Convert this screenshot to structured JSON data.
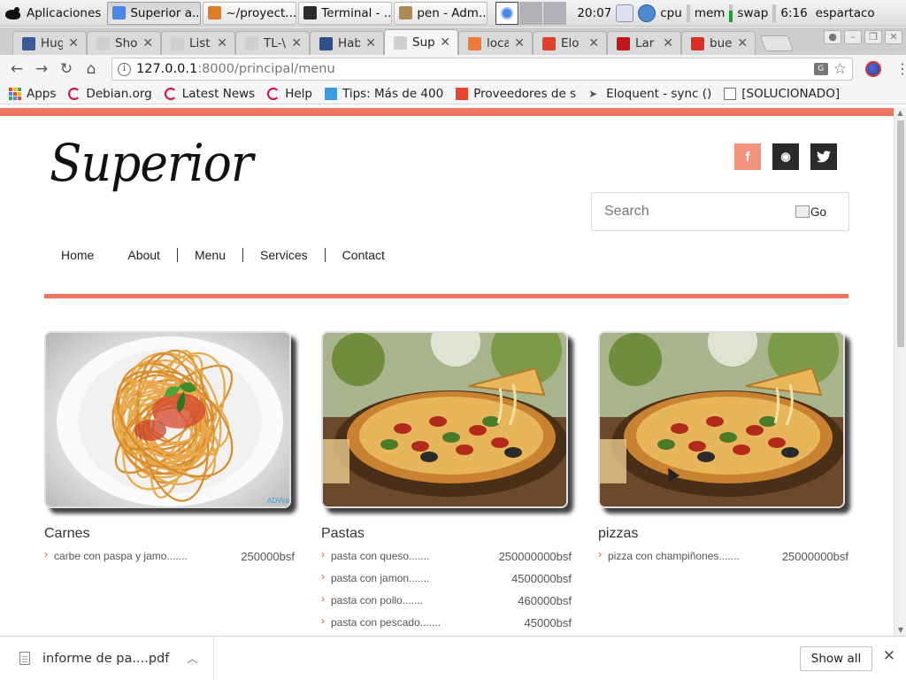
{
  "panel": {
    "apps_label": "Aplicaciones",
    "tasks": [
      {
        "label": "Superior a...",
        "color": "#4a86e8",
        "active": true
      },
      {
        "label": "~/proyect...",
        "color": "#e07b28",
        "active": false
      },
      {
        "label": "Terminal - ...",
        "color": "#2b2b2b",
        "active": false
      },
      {
        "label": "pen - Adm...",
        "color": "#b08a55",
        "active": false
      }
    ],
    "time": "20:07",
    "cpu_label": "cpu",
    "mem_label": "mem",
    "swap_label": "swap",
    "clock": "6:16",
    "user": "espartaco",
    "mem_level": 0.65
  },
  "browser": {
    "tabs": [
      {
        "label": "Hug",
        "fav_color": "#3b5998",
        "active": false
      },
      {
        "label": "Sho",
        "fav_color": "#cfcfcf",
        "active": false
      },
      {
        "label": "List",
        "fav_color": "#cfcfcf",
        "active": false
      },
      {
        "label": "TL-\\",
        "fav_color": "#cfcfcf",
        "active": false
      },
      {
        "label": "Hab",
        "fav_color": "#2f4f8a",
        "active": false
      },
      {
        "label": "Sup",
        "fav_color": "#cfcfcf",
        "active": true
      },
      {
        "label": "loca",
        "fav_color": "#f07a3a",
        "active": false
      },
      {
        "label": "Elo",
        "fav_color": "#e0402c",
        "active": false
      },
      {
        "label": "Lar",
        "fav_color": "#c4151c",
        "active": false
      },
      {
        "label": "bue",
        "fav_color": "#d93025",
        "active": false
      }
    ],
    "url_host": "127.0.0.1",
    "url_rest": ":8000/principal/menu",
    "bookmarks": [
      {
        "label": "Apps",
        "kind": "apps"
      },
      {
        "label": "Debian.org",
        "kind": "debian"
      },
      {
        "label": "Latest News",
        "kind": "debian"
      },
      {
        "label": "Help",
        "kind": "debian"
      },
      {
        "label": "Tips: Más de 400",
        "kind": "tips"
      },
      {
        "label": "Proveedores de s",
        "kind": "laravel"
      },
      {
        "label": "Eloquent - sync ()",
        "kind": "eloquent"
      },
      {
        "label": "[SOLUCIONADO]",
        "kind": "page"
      }
    ]
  },
  "site": {
    "logo": "Superior",
    "social": {
      "facebook": "f",
      "rss": "◉",
      "twitter": "t"
    },
    "search_placeholder": "Search",
    "search_go": "Go",
    "nav": [
      "Home",
      "About",
      "Menu",
      "Services",
      "Contact"
    ],
    "categories": [
      {
        "title": "Carnes",
        "image": "pasta",
        "items": [
          {
            "name": "carbe con paspa y jamo.......",
            "price": "250000bsf"
          }
        ]
      },
      {
        "title": "Pastas",
        "image": "pizza",
        "items": [
          {
            "name": "pasta con queso.......",
            "price": "250000000bsf"
          },
          {
            "name": "pasta con jamon.......",
            "price": "4500000bsf"
          },
          {
            "name": "pasta con pollo.......",
            "price": "460000bsf"
          },
          {
            "name": "pasta con pescado.......",
            "price": "45000bsf"
          }
        ]
      },
      {
        "title": "pizzas",
        "image": "pizza",
        "items": [
          {
            "name": "pizza con champiñones.......",
            "price": "25000000bsf"
          }
        ]
      }
    ]
  },
  "downloads": {
    "file": "informe de pa....pdf",
    "show_all": "Show all"
  },
  "colors": {
    "accent": "#f07561",
    "facebook": "#f5937e",
    "dark_social": "#2a2a2a"
  }
}
